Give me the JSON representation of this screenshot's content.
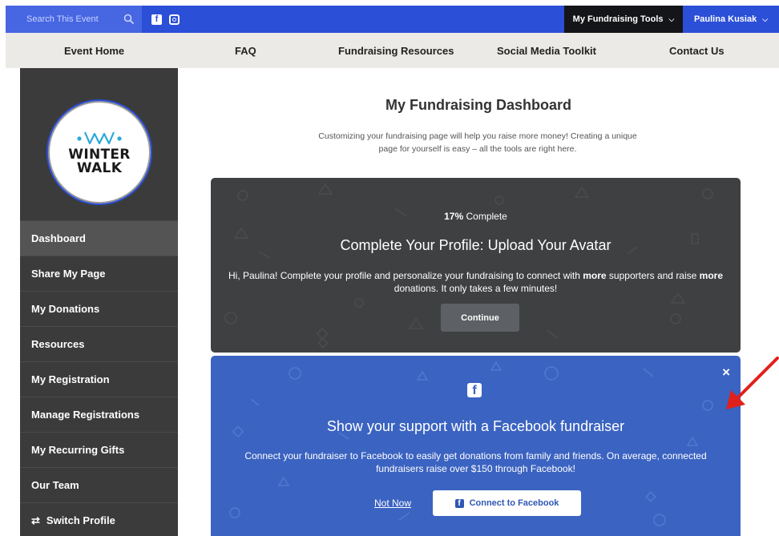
{
  "topbar": {
    "search_placeholder": "Search This Event",
    "facebook_glyph": "f",
    "tools_label": "My Fundraising Tools",
    "user_label": "Paulina Kusiak",
    "bg_color": "#2c4fd8"
  },
  "nav": {
    "items": [
      "Event Home",
      "FAQ",
      "Fundraising Resources",
      "Social Media Toolkit",
      "Contact Us"
    ]
  },
  "sidebar": {
    "logo_line1": "WINTER",
    "logo_line2": "WALK",
    "items": [
      {
        "label": "Dashboard",
        "active": true
      },
      {
        "label": "Share My Page"
      },
      {
        "label": "My Donations"
      },
      {
        "label": "Resources"
      },
      {
        "label": "My Registration"
      },
      {
        "label": "Manage Registrations"
      },
      {
        "label": "My Recurring Gifts"
      },
      {
        "label": "Our Team"
      },
      {
        "label": "Switch Profile",
        "icon": "shuffle-icon"
      }
    ]
  },
  "main": {
    "title": "My Fundraising Dashboard",
    "intro": "Customizing your fundraising page will help you raise more money! Creating a unique page for yourself is easy – all the tools are right here."
  },
  "profile_card": {
    "progress_value": "17%",
    "progress_suffix": " Complete",
    "heading": "Complete Your Profile: Upload Your Avatar",
    "msg_1": "Hi, Paulina! Complete your profile and personalize your fundraising to connect with ",
    "msg_bold_1": "more",
    "msg_2": " supporters and raise ",
    "msg_bold_2": "more",
    "msg_3": " donations. It only takes a few minutes!",
    "continue_label": "Continue"
  },
  "fb_card": {
    "close_glyph": "×",
    "logo_glyph": "f",
    "heading": "Show your support with a Facebook fundraiser",
    "message": "Connect your fundraiser to Facebook to easily get donations from family and friends. On average, connected fundraisers raise over $150 through Facebook!",
    "not_now_label": "Not Now",
    "connect_label": "Connect to Facebook",
    "bg_color": "#3b63c1"
  },
  "annotation": {
    "arrow_color": "#e0201b"
  }
}
